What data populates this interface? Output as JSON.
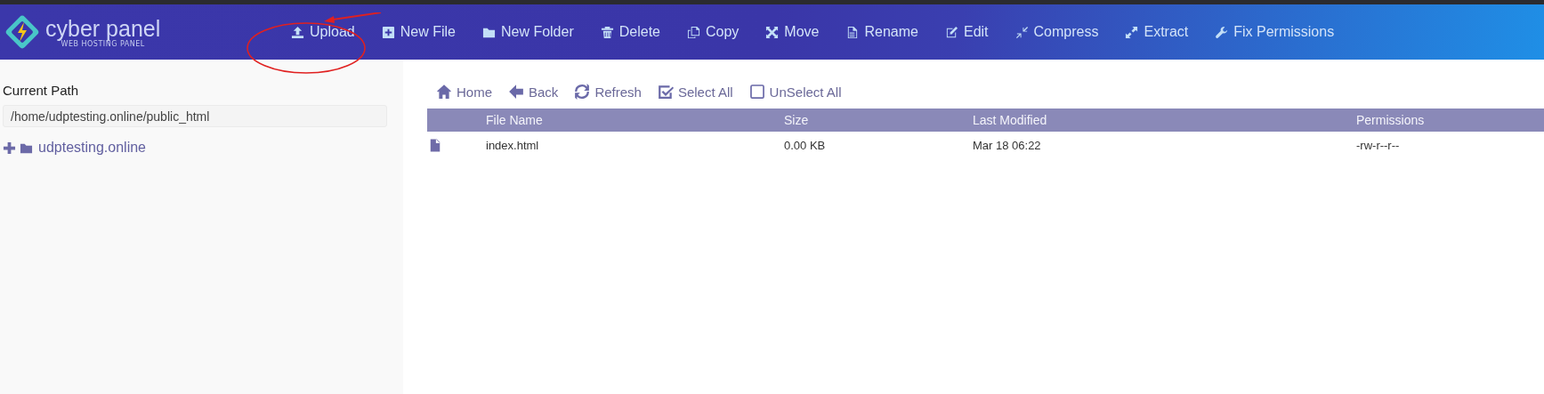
{
  "logo": {
    "name": "cyber panel",
    "tagline": "WEB HOSTING PANEL"
  },
  "actions": [
    {
      "label": "Upload",
      "kind": "upload"
    },
    {
      "label": "New File",
      "kind": "plus-square"
    },
    {
      "label": "New Folder",
      "kind": "folder"
    },
    {
      "label": "Delete",
      "kind": "trash"
    },
    {
      "label": "Copy",
      "kind": "copy"
    },
    {
      "label": "Move",
      "kind": "move"
    },
    {
      "label": "Rename",
      "kind": "file"
    },
    {
      "label": "Edit",
      "kind": "edit"
    },
    {
      "label": "Compress",
      "kind": "compress"
    },
    {
      "label": "Extract",
      "kind": "expand"
    },
    {
      "label": "Fix Permissions",
      "kind": "wrench"
    }
  ],
  "sidebar": {
    "title": "Current Path",
    "path": "/home/udptesting.online/public_html",
    "tree": [
      {
        "label": "udptesting.online",
        "expanded": false
      }
    ]
  },
  "file_toolbar": [
    {
      "label": "Home",
      "kind": "home"
    },
    {
      "label": "Back",
      "kind": "back"
    },
    {
      "label": "Refresh",
      "kind": "refresh"
    },
    {
      "label": "Select All",
      "kind": "check"
    },
    {
      "label": "UnSelect All",
      "kind": "box"
    }
  ],
  "table": {
    "columns": [
      "File Name",
      "Size",
      "Last Modified",
      "Permissions"
    ],
    "rows": [
      {
        "kind": "file",
        "cells": [
          "index.html",
          "0.00 KB",
          "Mar 18 06:22",
          "-rw-r--r--"
        ]
      }
    ]
  }
}
